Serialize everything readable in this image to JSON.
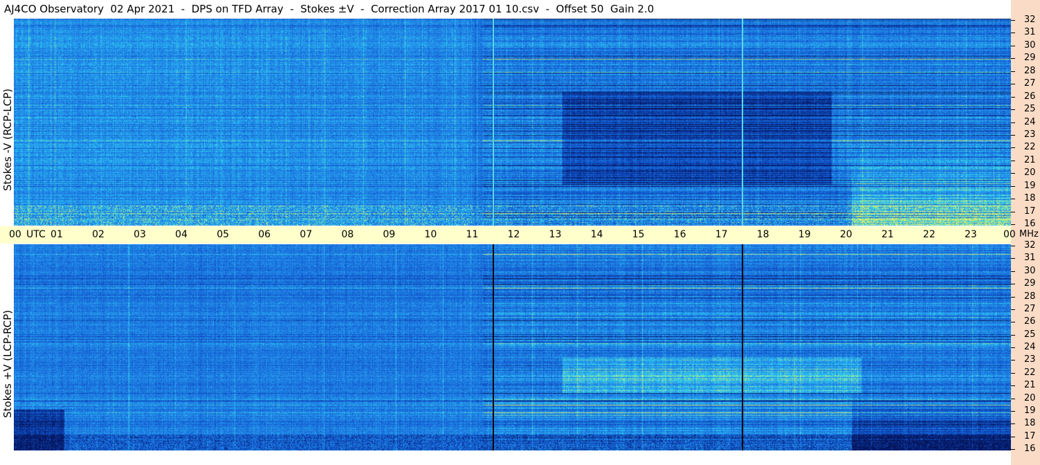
{
  "title": "AJ4CO Observatory  02 Apr 2021  -  DPS on TFD Array  -  Stokes ±V  -  Correction Array 2017 01 10.csv  -  Offset 50  Gain 2.0",
  "top_panel_label": "Stokes -V (RCP-LCP)",
  "bottom_panel_label": "Stokes +V (LCP-RCP)",
  "time_unit": "UTC",
  "freq_unit": "MHz",
  "colors": {
    "background_blue": "#1a6fe6",
    "dark_blue": "#0a2d9a",
    "light_blue": "#2ea8f0",
    "cyan": "#27d8e0",
    "yellow": "#e8e84a",
    "time_band": "#ffffcc",
    "right_strip": "#fadcc6"
  },
  "chart_data": {
    "type": "heatmap",
    "panels": [
      {
        "name": "Stokes -V (RCP-LCP)",
        "marker_lines_utc": [
          11.52,
          17.52
        ],
        "marker_color": "#5ad7e8"
      },
      {
        "name": "Stokes +V (LCP-RCP)",
        "marker_lines_utc": [
          11.52,
          17.52
        ],
        "marker_color": "#000000"
      }
    ],
    "x_ticks_utc": [
      "00",
      "01",
      "02",
      "03",
      "04",
      "05",
      "06",
      "07",
      "08",
      "09",
      "10",
      "11",
      "12",
      "13",
      "14",
      "15",
      "16",
      "17",
      "18",
      "19",
      "20",
      "21",
      "22",
      "23",
      "00"
    ],
    "y_ticks_mhz": [
      "16",
      "17",
      "18",
      "19",
      "20",
      "21",
      "22",
      "23",
      "24",
      "25",
      "26",
      "27",
      "28",
      "29",
      "30",
      "31",
      "32"
    ],
    "xlim_utc": [
      0,
      24
    ],
    "ylim_mhz": [
      16,
      32
    ]
  }
}
